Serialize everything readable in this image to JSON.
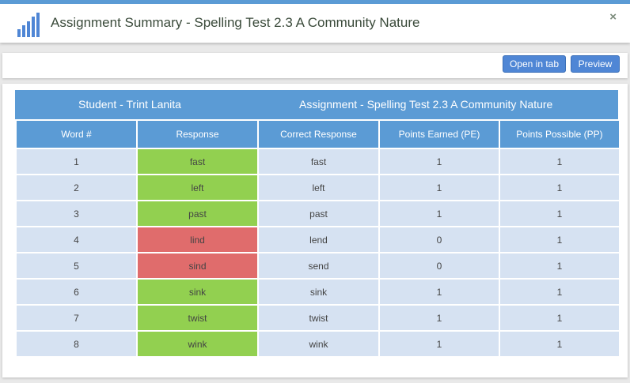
{
  "header": {
    "title": "Assignment Summary - Spelling Test 2.3 A Community Nature",
    "close_label": "×"
  },
  "toolbar": {
    "open_in_tab": "Open in tab",
    "preview": "Preview"
  },
  "summary": {
    "student": "Student - Trint Lanita",
    "assignment": "Assignment - Spelling Test 2.3 A Community Nature"
  },
  "table": {
    "columns": [
      "Word #",
      "Response",
      "Correct Response",
      "Points Earned (PE)",
      "Points Possible (PP)"
    ],
    "rows": [
      {
        "num": "1",
        "response": "fast",
        "correct": "fast",
        "earned": "1",
        "possible": "1",
        "status": "correct"
      },
      {
        "num": "2",
        "response": "left",
        "correct": "left",
        "earned": "1",
        "possible": "1",
        "status": "correct"
      },
      {
        "num": "3",
        "response": "past",
        "correct": "past",
        "earned": "1",
        "possible": "1",
        "status": "correct"
      },
      {
        "num": "4",
        "response": "lind",
        "correct": "lend",
        "earned": "0",
        "possible": "1",
        "status": "incorrect"
      },
      {
        "num": "5",
        "response": "sind",
        "correct": "send",
        "earned": "0",
        "possible": "1",
        "status": "incorrect"
      },
      {
        "num": "6",
        "response": "sink",
        "correct": "sink",
        "earned": "1",
        "possible": "1",
        "status": "correct"
      },
      {
        "num": "7",
        "response": "twist",
        "correct": "twist",
        "earned": "1",
        "possible": "1",
        "status": "correct"
      },
      {
        "num": "8",
        "response": "wink",
        "correct": "wink",
        "earned": "1",
        "possible": "1",
        "status": "correct"
      }
    ]
  },
  "colors": {
    "accent": "#5b9bd5",
    "button": "#4f86d5",
    "correct": "#92d050",
    "incorrect": "#e06c6c",
    "cell": "#d6e2f2"
  },
  "icons": {
    "logo": "bar-chart-icon",
    "close": "close-icon"
  }
}
